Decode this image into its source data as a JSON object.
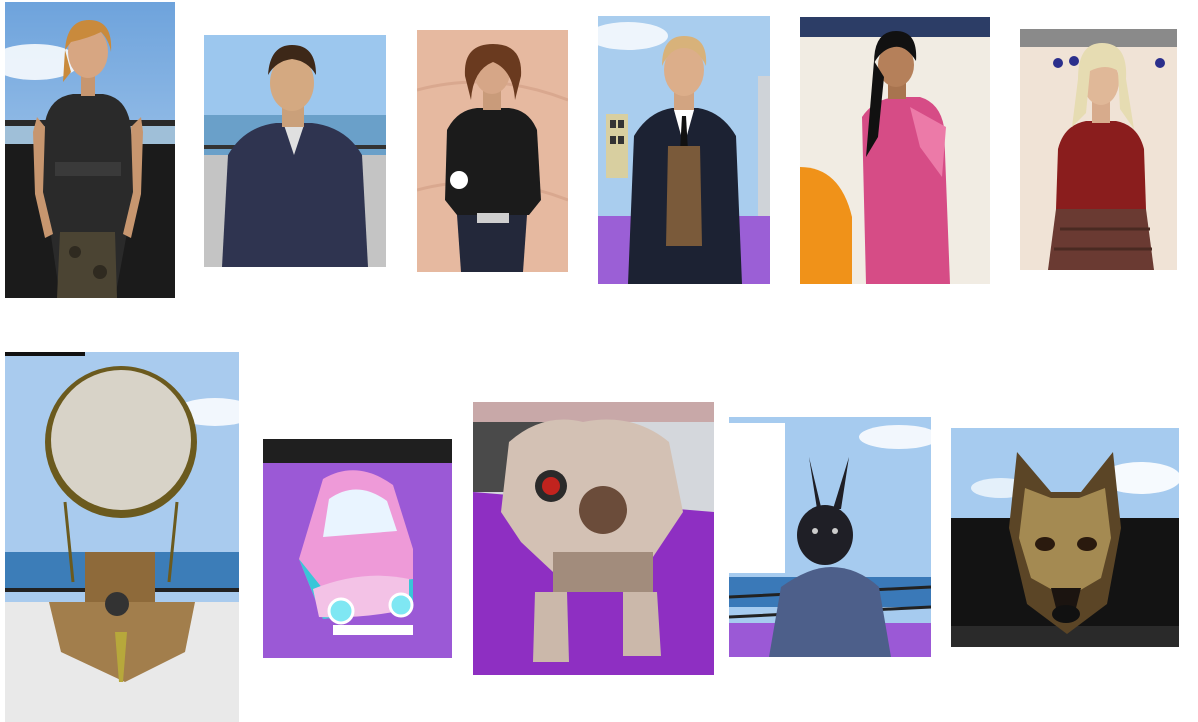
{
  "avatars_top": [
    {
      "subject": "avatar-woman-black-tank-top"
    },
    {
      "subject": "avatar-man-denim-jacket"
    },
    {
      "subject": "avatar-woman-leather-jacket"
    },
    {
      "subject": "avatar-man-suit-tie"
    },
    {
      "subject": "avatar-woman-pink-sari"
    },
    {
      "subject": "avatar-woman-red-sweater"
    }
  ],
  "avatars_bottom": [
    {
      "subject": "avatar-hot-air-balloon"
    },
    {
      "subject": "avatar-cartoon-car"
    },
    {
      "subject": "avatar-robot"
    },
    {
      "subject": "avatar-rabbit"
    },
    {
      "subject": "avatar-dog"
    }
  ]
}
